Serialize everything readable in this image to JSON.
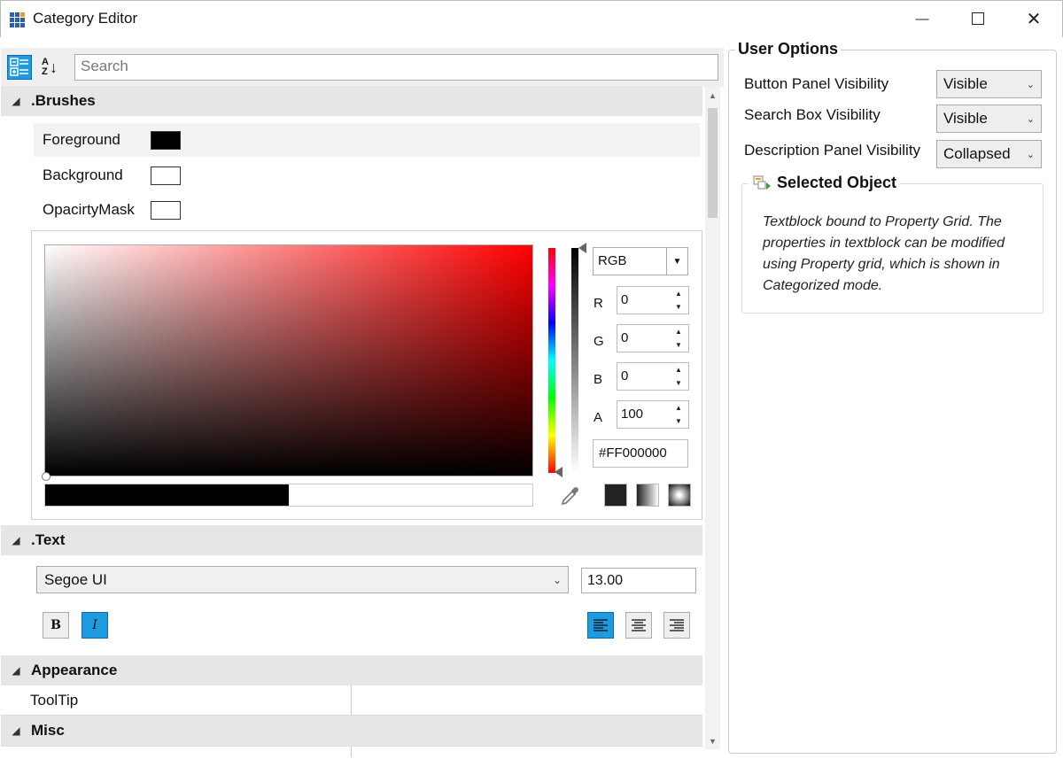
{
  "window": {
    "title": "Category Editor",
    "minimize_glyph": "—",
    "maximize_glyph": "☐",
    "close_glyph": "✕"
  },
  "toolbar": {
    "categorized_icon": "categorized-view-icon",
    "sort_icon": "sort-az-icon",
    "sort_label_top": "A",
    "sort_label_bottom": "Z",
    "search_placeholder": "Search"
  },
  "categories": {
    "brushes": ".Brushes",
    "text": ".Text",
    "appearance": "Appearance",
    "misc": "Misc"
  },
  "brushes": [
    {
      "label": "Foreground",
      "color": "#000000"
    },
    {
      "label": "Background",
      "color": "#ffffff"
    },
    {
      "label": "OpacirtyMask",
      "color": "#ffffff"
    }
  ],
  "color_picker": {
    "mode": "RGB",
    "channels": [
      {
        "label": "R",
        "value": "0"
      },
      {
        "label": "G",
        "value": "0"
      },
      {
        "label": "B",
        "value": "0"
      },
      {
        "label": "A",
        "value": "100"
      }
    ],
    "hex": "#FF000000"
  },
  "text_props": {
    "font_family": "Segoe UI",
    "font_size": "13.00",
    "bold_label": "B",
    "italic_label": "I"
  },
  "appearance_props": [
    {
      "label": "ToolTip",
      "value": ""
    }
  ],
  "user_options": {
    "title": "User Options",
    "rows": [
      {
        "label": "Button Panel Visibility",
        "value": "Visible"
      },
      {
        "label": "Search Box Visibility",
        "value": "Visible"
      },
      {
        "label": "Description Panel Visibility",
        "value": "Collapsed"
      }
    ]
  },
  "selected_object": {
    "title": "Selected Object",
    "description": "Textblock bound to Property Grid. The properties in textblock can be modified using Property grid, which is shown in Categorized mode."
  },
  "colors": {
    "accent": "#1e9ae0",
    "header_bg": "#e6e6e6"
  }
}
